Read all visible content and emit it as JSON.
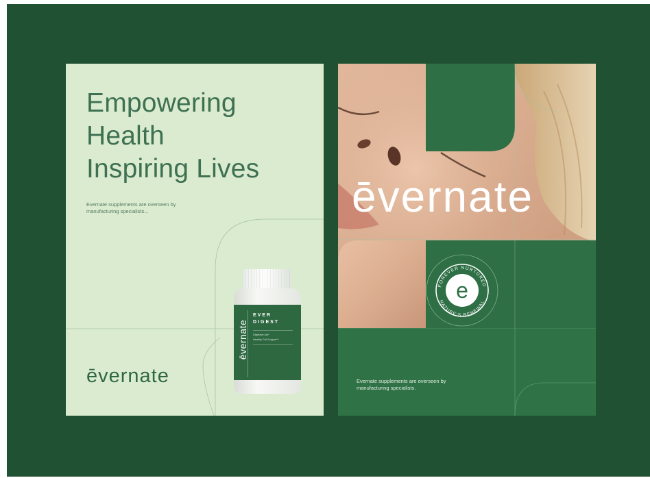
{
  "left_poster": {
    "headline": [
      "Empowering",
      "Health",
      "Inspiring Lives"
    ],
    "body_text": "Evernate supplements are overseen by manufacturing specialists...",
    "wordmark": "ēvernate",
    "bottle": {
      "brand": "ēvernate",
      "name_line1": "EVER",
      "name_line2": "DIGEST",
      "detail_line1": "Digestive Aid*",
      "detail_line2": "Healthy Gut Support**"
    }
  },
  "right_poster": {
    "wordmark": "ēvernate",
    "seal_text_top": "FOREVER NURTURED",
    "seal_text_bottom": "NATURE'S RENEWAL",
    "seal_letter": "e",
    "body_text": "Evernate supplements are overseen by manufacturing specialists."
  },
  "colors": {
    "background": "#215133",
    "left_poster_bg": "#dbebd0",
    "brand_green": "#2e6f45",
    "headline_green": "#3e7052"
  }
}
